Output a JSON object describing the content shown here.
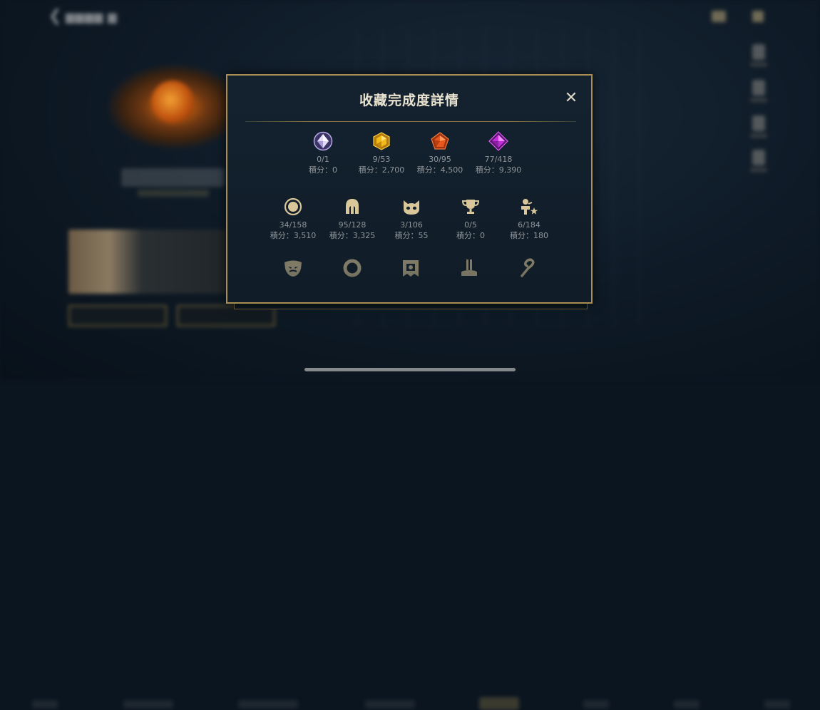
{
  "modal": {
    "title": "收藏完成度詳情",
    "close_symbol": "✕"
  },
  "gems": [
    {
      "icon": "diamond-crystal-icon",
      "color": "#d8c8f0",
      "progress": "0/1",
      "score": "積分：0"
    },
    {
      "icon": "gold-gem-icon",
      "color": "#e8b020",
      "progress": "9/53",
      "score": "積分：2,700"
    },
    {
      "icon": "orange-gem-icon",
      "color": "#e8601c",
      "progress": "30/95",
      "score": "積分：4,500"
    },
    {
      "icon": "purple-gem-icon",
      "color": "#c22fd8",
      "progress": "77/418",
      "score": "積分：9,390"
    }
  ],
  "categories": [
    {
      "icon": "circle-badge-icon",
      "progress": "34/158",
      "score": "積分：3,510"
    },
    {
      "icon": "helmet-icon",
      "progress": "95/128",
      "score": "積分：3,325"
    },
    {
      "icon": "cat-face-icon",
      "progress": "3/106",
      "score": "積分：55"
    },
    {
      "icon": "trophy-icon",
      "progress": "0/5",
      "score": "積分：0"
    },
    {
      "icon": "player-star-icon",
      "progress": "6/184",
      "score": "積分：180"
    }
  ],
  "more_categories": [
    {
      "icon": "mask-icon"
    },
    {
      "icon": "ring-icon"
    },
    {
      "icon": "banner-frame-icon"
    },
    {
      "icon": "pedestal-icon"
    },
    {
      "icon": "hook-emote-icon"
    }
  ],
  "colors": {
    "accent_gold": "#a88e52",
    "icon_gold": "#d9c79a",
    "text_muted": "#8f9598",
    "title": "#e8e2cf"
  }
}
